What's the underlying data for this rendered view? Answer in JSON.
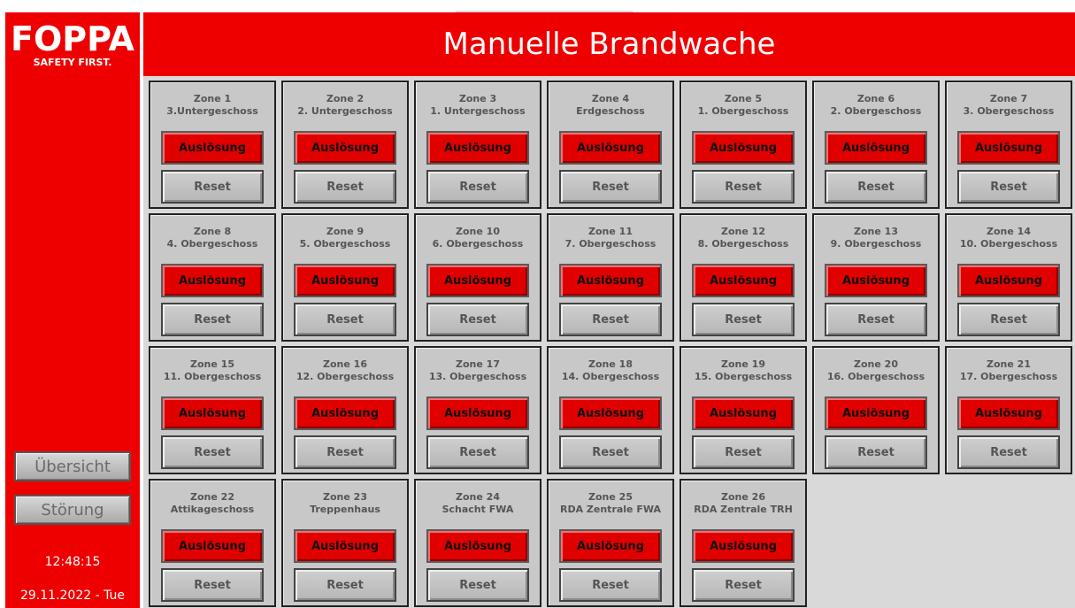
{
  "logo": {
    "name": "FOPPA",
    "tagline": "SAFETY FIRST."
  },
  "header": {
    "title": "Manuelle Brandwache"
  },
  "sidebar": {
    "overview_label": "Übersicht",
    "fault_label": "Störung",
    "time": "12:48:15",
    "date": "29.11.2022 - Tue"
  },
  "zones": [
    {
      "name": "Zone 1",
      "floor": "3.Untergeschoss",
      "trigger": "Auslösung",
      "reset": "Reset"
    },
    {
      "name": "Zone 2",
      "floor": "2. Untergeschoss",
      "trigger": "Auslösung",
      "reset": "Reset"
    },
    {
      "name": "Zone 3",
      "floor": "1. Untergeschoss",
      "trigger": "Auslösung",
      "reset": "Reset"
    },
    {
      "name": "Zone 4",
      "floor": "Erdgeschoss",
      "trigger": "Auslösung",
      "reset": "Reset"
    },
    {
      "name": "Zone 5",
      "floor": "1. Obergeschoss",
      "trigger": "Auslösung",
      "reset": "Reset"
    },
    {
      "name": "Zone 6",
      "floor": "2. Obergeschoss",
      "trigger": "Auslösung",
      "reset": "Reset"
    },
    {
      "name": "Zone 7",
      "floor": "3. Obergeschoss",
      "trigger": "Auslösung",
      "reset": "Reset"
    },
    {
      "name": "Zone 8",
      "floor": "4. Obergeschoss",
      "trigger": "Auslösung",
      "reset": "Reset"
    },
    {
      "name": "Zone 9",
      "floor": "5. Obergeschoss",
      "trigger": "Auslösung",
      "reset": "Reset"
    },
    {
      "name": "Zone 10",
      "floor": "6. Obergeschoss",
      "trigger": "Auslösung",
      "reset": "Reset"
    },
    {
      "name": "Zone 11",
      "floor": "7. Obergeschoss",
      "trigger": "Auslösung",
      "reset": "Reset"
    },
    {
      "name": "Zone 12",
      "floor": "8. Obergeschoss",
      "trigger": "Auslösung",
      "reset": "Reset"
    },
    {
      "name": "Zone 13",
      "floor": "9. Obergeschoss",
      "trigger": "Auslösung",
      "reset": "Reset"
    },
    {
      "name": "Zone 14",
      "floor": "10. Obergeschoss",
      "trigger": "Auslösung",
      "reset": "Reset"
    },
    {
      "name": "Zone 15",
      "floor": "11. Obergeschoss",
      "trigger": "Auslösung",
      "reset": "Reset"
    },
    {
      "name": "Zone 16",
      "floor": "12. Obergeschoss",
      "trigger": "Auslösung",
      "reset": "Reset"
    },
    {
      "name": "Zone 17",
      "floor": "13. Obergeschoss",
      "trigger": "Auslösung",
      "reset": "Reset"
    },
    {
      "name": "Zone 18",
      "floor": "14. Obergeschoss",
      "trigger": "Auslösung",
      "reset": "Reset"
    },
    {
      "name": "Zone 19",
      "floor": "15. Obergeschoss",
      "trigger": "Auslösung",
      "reset": "Reset"
    },
    {
      "name": "Zone 20",
      "floor": "16. Obergeschoss",
      "trigger": "Auslösung",
      "reset": "Reset"
    },
    {
      "name": "Zone 21",
      "floor": "17. Obergeschoss",
      "trigger": "Auslösung",
      "reset": "Reset"
    },
    {
      "name": "Zone 22",
      "floor": "Attikageschoss",
      "trigger": "Auslösung",
      "reset": "Reset"
    },
    {
      "name": "Zone 23",
      "floor": "Treppenhaus",
      "trigger": "Auslösung",
      "reset": "Reset"
    },
    {
      "name": "Zone 24",
      "floor": "Schacht FWA",
      "trigger": "Auslösung",
      "reset": "Reset"
    },
    {
      "name": "Zone 25",
      "floor": "RDA Zentrale FWA",
      "trigger": "Auslösung",
      "reset": "Reset"
    },
    {
      "name": "Zone 26",
      "floor": "RDA Zentrale TRH",
      "trigger": "Auslösung",
      "reset": "Reset"
    }
  ]
}
